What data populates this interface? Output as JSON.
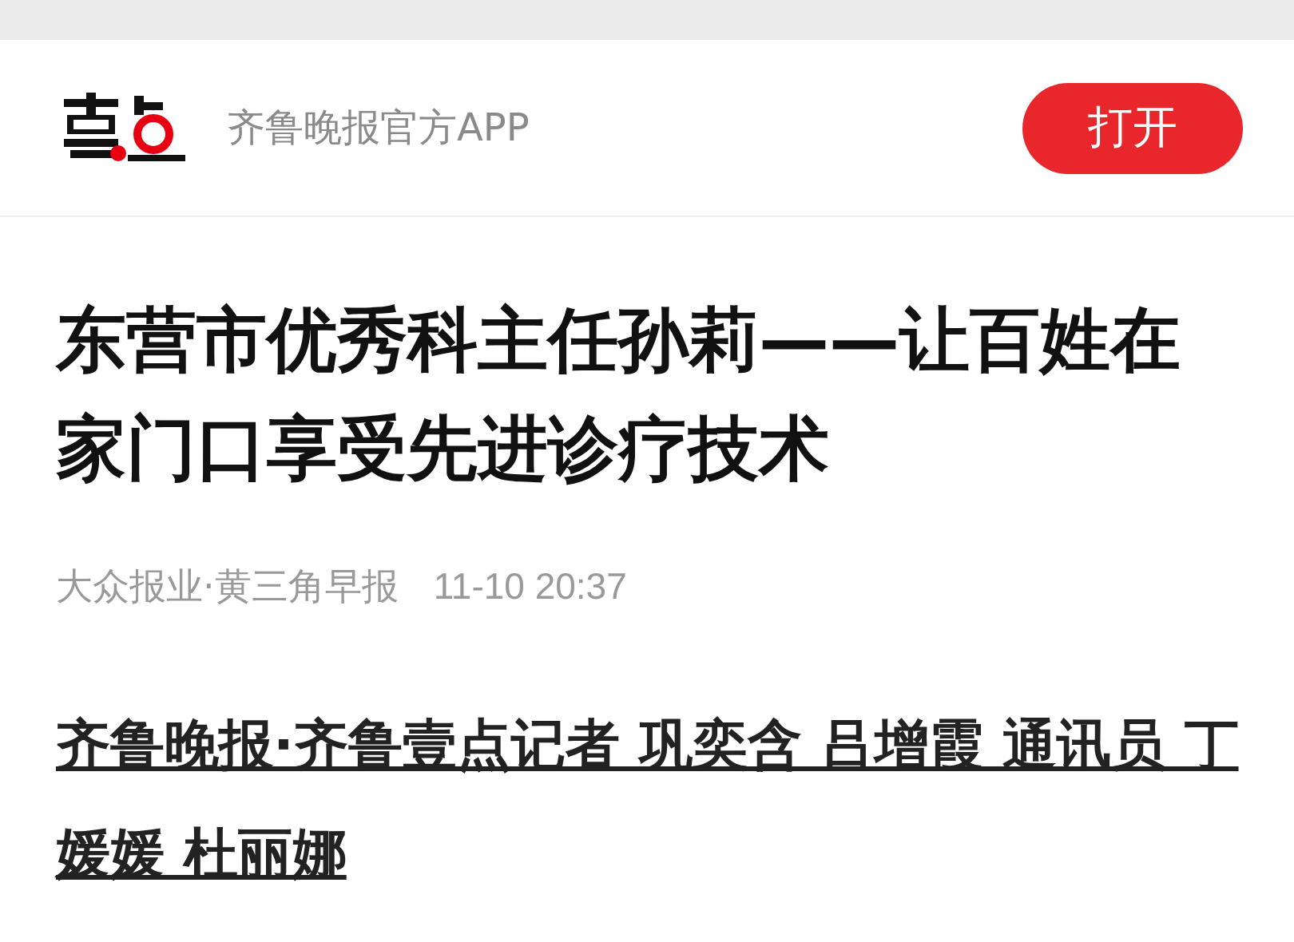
{
  "header": {
    "app_name": "齐鲁晚报官方APP",
    "open_button": "打开"
  },
  "article": {
    "title": "东营市优秀科主任孙莉——让百姓在家门口享受先进诊疗技术",
    "source": "大众报业·黄三角早报",
    "time": "11-10 20:37",
    "byline": "齐鲁晚报·齐鲁壹点记者 巩奕含 吕增霞 通讯员 丁媛媛 杜丽娜"
  }
}
